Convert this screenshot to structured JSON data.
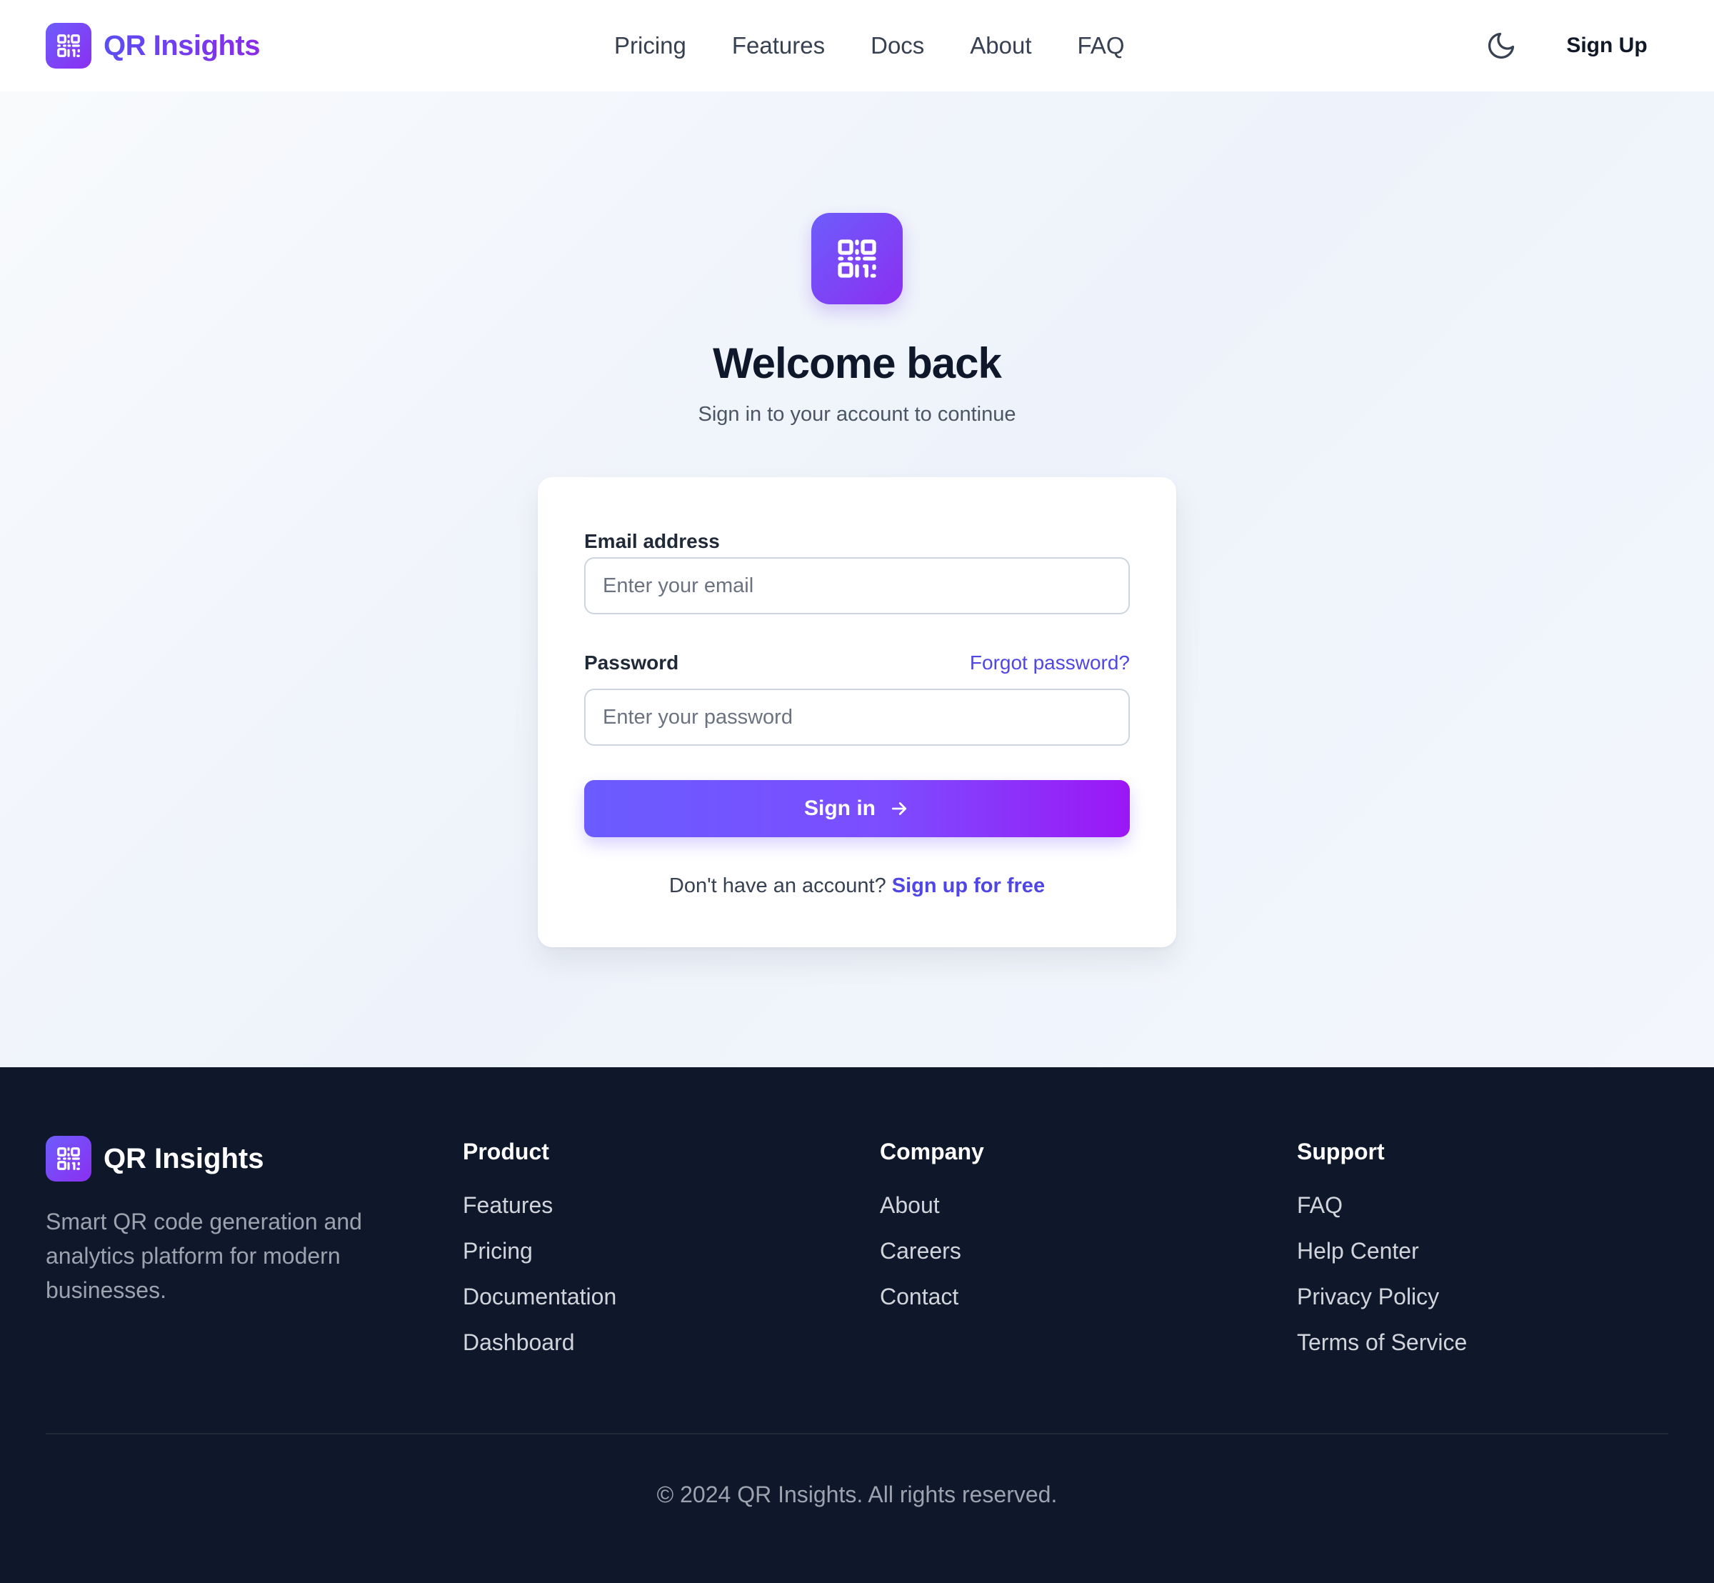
{
  "brand": {
    "name": "QR Insights",
    "logo_icon": "qr-code-icon"
  },
  "nav": {
    "items": [
      "Pricing",
      "Features",
      "Docs",
      "About",
      "FAQ"
    ]
  },
  "header": {
    "theme_icon": "moon-icon",
    "signup_label": "Sign Up"
  },
  "login": {
    "title": "Welcome back",
    "subtitle": "Sign in to your account to continue",
    "email_label": "Email address",
    "email_placeholder": "Enter your email",
    "email_value": "",
    "password_label": "Password",
    "password_placeholder": "Enter your password",
    "password_value": "",
    "forgot_label": "Forgot password?",
    "signin_label": "Sign in",
    "signin_icon": "arrow-right-icon",
    "no_account_text": "Don't have an account?",
    "signup_link": "Sign up for free"
  },
  "footer": {
    "brand_name": "QR Insights",
    "tagline": "Smart QR code generation and analytics platform for modern businesses.",
    "columns": [
      {
        "title": "Product",
        "links": [
          "Features",
          "Pricing",
          "Documentation",
          "Dashboard"
        ]
      },
      {
        "title": "Company",
        "links": [
          "About",
          "Careers",
          "Contact"
        ]
      },
      {
        "title": "Support",
        "links": [
          "FAQ",
          "Help Center",
          "Privacy Policy",
          "Terms of Service"
        ]
      }
    ],
    "copyright": "© 2024 QR Insights. All rights reserved."
  },
  "colors": {
    "accent": "#4f46e5",
    "gradient_start": "#6a5cff",
    "gradient_end": "#9b17f5",
    "footer_bg": "#0f172a"
  }
}
